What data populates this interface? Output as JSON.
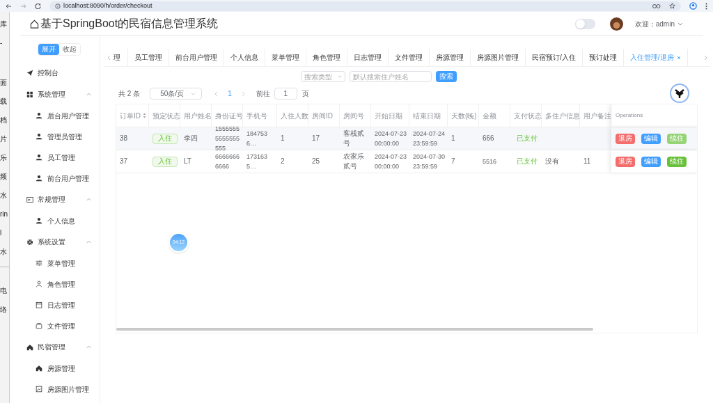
{
  "browser": {
    "url": "localhost:8090/h/order/checkout"
  },
  "background_window": {
    "groups": [
      [
        "库",
        "-"
      ],
      [
        "面",
        "载",
        "档",
        "片",
        "乐",
        "频",
        "水",
        "rin",
        "l",
        "水"
      ],
      [
        "电",
        "络"
      ]
    ]
  },
  "header": {
    "title": "基于SpringBoot的民宿信息管理系统",
    "theme_switch": {
      "on": false
    },
    "user": "欢迎：admin"
  },
  "sidebar": {
    "toggle_buttons": [
      {
        "label": "展开",
        "selected": true
      },
      {
        "label": "收起",
        "selected": false
      }
    ],
    "items": [
      {
        "label": "控制台"
      },
      {
        "label": "系统管理",
        "expanded": true,
        "children": [
          {
            "label": "后台用户管理"
          },
          {
            "label": "管理员管理"
          },
          {
            "label": "员工管理"
          },
          {
            "label": "前台用户管理"
          }
        ]
      },
      {
        "label": "常规管理",
        "expanded": true,
        "children": [
          {
            "label": "个人信息"
          }
        ]
      },
      {
        "label": "系统设置",
        "expanded": true,
        "children": [
          {
            "label": "菜单管理"
          },
          {
            "label": "角色管理"
          },
          {
            "label": "日志管理"
          },
          {
            "label": "文件管理"
          }
        ]
      },
      {
        "label": "民宿管理",
        "expanded": true,
        "children": [
          {
            "label": "房源管理"
          },
          {
            "label": "房源图片管理"
          }
        ]
      }
    ]
  },
  "tabs": [
    {
      "label": "理",
      "selected": false
    },
    {
      "label": "员工管理",
      "selected": false
    },
    {
      "label": "前台用户管理",
      "selected": false
    },
    {
      "label": "个人信息",
      "selected": false
    },
    {
      "label": "菜单管理",
      "selected": false
    },
    {
      "label": "角色管理",
      "selected": false
    },
    {
      "label": "日志管理",
      "selected": false
    },
    {
      "label": "文件管理",
      "selected": false
    },
    {
      "label": "房源管理",
      "selected": false
    },
    {
      "label": "房源图片管理",
      "selected": false
    },
    {
      "label": "民宿预订/入住",
      "selected": false
    },
    {
      "label": "预订处理",
      "selected": false
    },
    {
      "label": "入住管理/退房",
      "selected": true
    }
  ],
  "search": {
    "type_placeholder": "搜索类型",
    "placeholder": "默认搜索住户姓名",
    "button": "搜索"
  },
  "pagination": {
    "total": "共 2 条",
    "page_size": "50条/页",
    "pages": [
      {
        "label": "1",
        "selected": true
      }
    ],
    "goto_label": "前往",
    "goto_value": "1",
    "page_unit": "页"
  },
  "table": {
    "columns": [
      {
        "label": "订单ID",
        "sortable": true
      },
      {
        "label": "预定状态",
        "kind": "tag"
      },
      {
        "label": "用户姓名"
      },
      {
        "label": "身份证号"
      },
      {
        "label": "手机号"
      },
      {
        "label": "入住人数"
      },
      {
        "label": "房间ID"
      },
      {
        "label": "房间号"
      },
      {
        "label": "开始日期"
      },
      {
        "label": "结束日期"
      },
      {
        "label": "天数(晚)"
      },
      {
        "label": "金额"
      },
      {
        "label": "支付状态",
        "kind": "paid"
      },
      {
        "label": "多住户信息"
      },
      {
        "label": "用户备注"
      }
    ],
    "operations_label": "Operations",
    "rows": [
      {
        "cells": [
          "38",
          "入住",
          "李四",
          "15555555555555555",
          "1847536…",
          "1",
          "17",
          "客栈贰号",
          "2024-07-23 00:00:00",
          "2024-07-24 23:59:59",
          "1",
          "666",
          "已支付",
          "",
          ""
        ],
        "actions": [
          {
            "label": "退房",
            "kind": "danger",
            "hovered": false
          },
          {
            "label": "编辑",
            "kind": "primary",
            "hovered": false
          },
          {
            "label": "续住",
            "kind": "success",
            "hovered": true
          }
        ]
      },
      {
        "cells": [
          "37",
          "入住",
          "LT",
          "66666666666",
          "1731635…",
          "2",
          "25",
          "农家乐贰号",
          "2024-07-23 00:00:00",
          "2024-07-30 23:59:59",
          "7",
          "5516",
          "已支付",
          "没有",
          "11"
        ],
        "actions": [
          {
            "label": "退房",
            "kind": "danger",
            "hovered": false
          },
          {
            "label": "编辑",
            "kind": "primary",
            "hovered": false
          },
          {
            "label": "续住",
            "kind": "success",
            "hovered": false
          }
        ]
      }
    ]
  },
  "timer": "04:12"
}
